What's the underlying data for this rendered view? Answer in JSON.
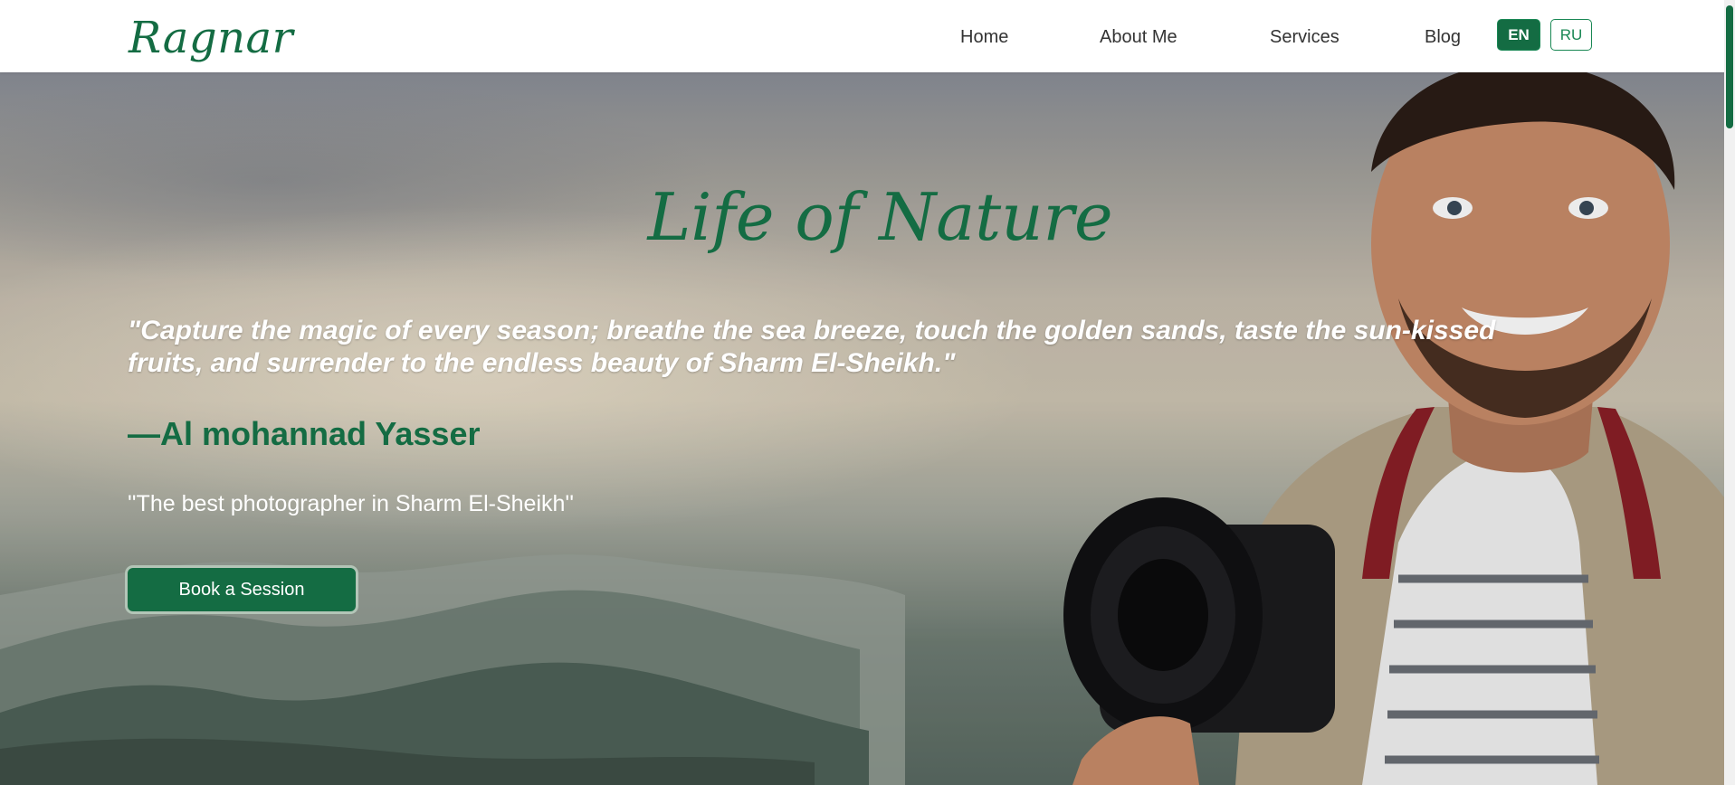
{
  "navbar": {
    "brand": "Ragnar",
    "links": [
      "Home",
      "About Me",
      "Services",
      "Blog"
    ],
    "lang_en": "EN",
    "lang_ru": "RU",
    "active_lang": "EN"
  },
  "hero": {
    "title": "Life of Nature",
    "quote": "\"Capture the magic of every season; breathe the sea breeze, touch the golden sands, taste the sun-kissed fruits, and surrender to the endless beauty of Sharm El-Sheikh.\"",
    "author": "—Al mohannad Yasser",
    "tagline": "''The best photographer in Sharm El-Sheikh''",
    "cta": "Book a Session",
    "background": "photographer-with-camera-over-misty-mountains"
  },
  "colors": {
    "accent": "#146c43",
    "nav_bg": "#ffffff",
    "text_light": "#ffffff"
  }
}
